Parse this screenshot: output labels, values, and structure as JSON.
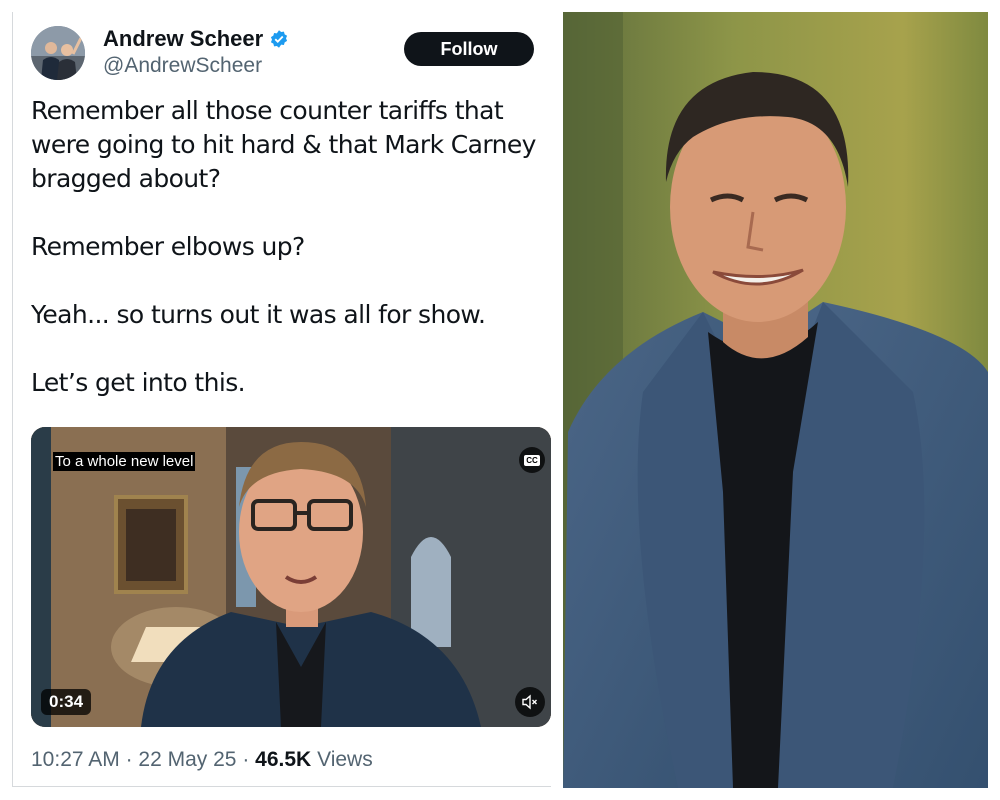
{
  "tweet": {
    "author_name": "Andrew Scheer",
    "author_handle": "@AndrewScheer",
    "verified_icon": "verified-badge-icon",
    "follow_label": "Follow",
    "paragraphs": [
      "Remember all those counter tariffs that were going to hit hard & that Mark Carney bragged about?",
      "Remember elbows up?",
      "Yeah... so turns out it was all for show.",
      "Let’s get into this."
    ],
    "video": {
      "caption": "To a whole new level",
      "cc_label": "CC",
      "duration": "0:34",
      "mute_icon": "speaker-muted-icon"
    },
    "time": "10:27 AM",
    "separator": "·",
    "date": "22 May 25",
    "views_count": "46.5K",
    "views_label": "Views"
  },
  "colors": {
    "text_primary": "#0f1419",
    "text_secondary": "#536471",
    "verified_blue": "#1d9bf0",
    "follow_bg": "#0f1419"
  }
}
